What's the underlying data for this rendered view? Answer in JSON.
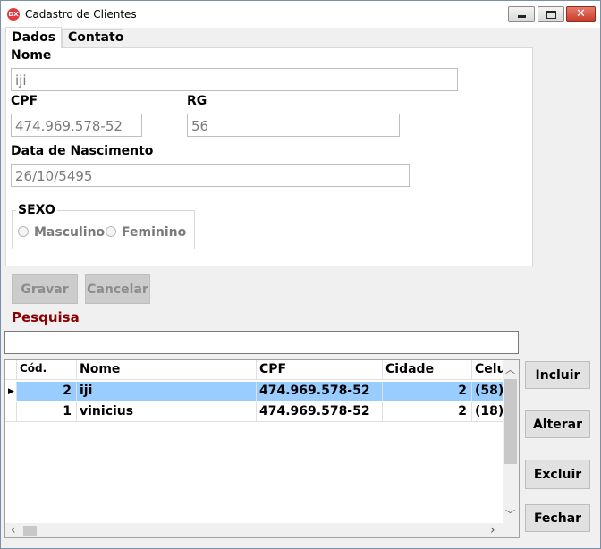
{
  "window": {
    "title": "Cadastro de Clientes",
    "icon": "app-logo-icon",
    "close_glyph": "✕"
  },
  "tabs": [
    {
      "label": "Dados"
    },
    {
      "label": "Contato"
    }
  ],
  "form": {
    "nome_label": "Nome",
    "nome_value": "iji",
    "cpf_label": "CPF",
    "cpf_value": "474.969.578-52",
    "rg_label": "RG",
    "rg_value": "56",
    "nascimento_label": "Data de Nascimento",
    "nascimento_value": "26/10/5495",
    "sexo_title": "SEXO",
    "sexo_options": [
      "Masculino",
      "Feminino"
    ]
  },
  "actions": {
    "gravar": "Gravar",
    "cancelar": "Cancelar"
  },
  "search": {
    "label": "Pesquisa",
    "value": ""
  },
  "grid": {
    "columns": [
      "Cód.",
      "Nome",
      "CPF",
      "Cidade",
      "Celu"
    ],
    "rows": [
      {
        "cod": "2",
        "nome": "iji",
        "cpf": "474.969.578-52",
        "cidade": "2",
        "celular": "(58)"
      },
      {
        "cod": "1",
        "nome": "vinicius",
        "cpf": "474.969.578-52",
        "cidade": "2",
        "celular": "(18)"
      }
    ],
    "row_pointer": "▶"
  },
  "side_buttons": {
    "incluir": "Incluir",
    "alterar": "Alterar",
    "excluir": "Excluir",
    "fechar": "Fechar"
  },
  "scroll": {
    "up": "︿",
    "down": "﹀",
    "left": "‹",
    "right": "›"
  },
  "colors": {
    "selected_row": "#99ccff",
    "search_label": "#8b0000",
    "close_button": "#c53b27"
  }
}
